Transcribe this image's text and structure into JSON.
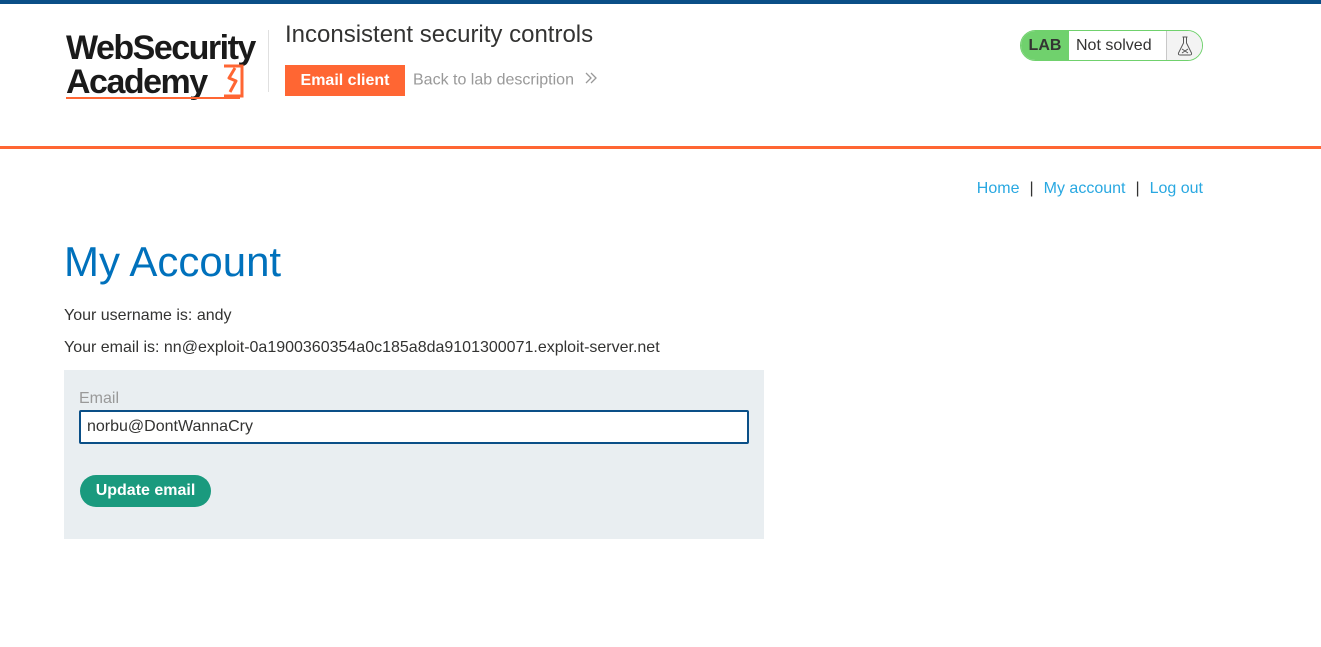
{
  "header": {
    "logo_text_line1": "WebSecurity",
    "logo_text_line2": "Academy",
    "lab_title": "Inconsistent security controls",
    "email_client_label": "Email client",
    "back_link_label": "Back to lab description",
    "status": {
      "badge": "LAB",
      "state": "Not solved",
      "icon": "flask-icon"
    }
  },
  "nav": {
    "home": "Home",
    "my_account": "My account",
    "log_out": "Log out",
    "separator": "|"
  },
  "main": {
    "title": "My Account",
    "username_line": "Your username is: andy",
    "email_line": "Your email is: nn@exploit-0a1900360354a0c185a8da9101300071.exploit-server.net",
    "form": {
      "label": "Email",
      "value": "norbu@DontWannaCry",
      "submit_label": "Update email"
    }
  },
  "colors": {
    "brand_orange": "#ff6633",
    "brand_blue": "#0a4f87",
    "link_blue": "#29a8e1",
    "title_blue": "#0071bc",
    "status_green": "#70d16d",
    "button_green": "#1a9a7e",
    "panel_gray": "#e9eef1"
  }
}
